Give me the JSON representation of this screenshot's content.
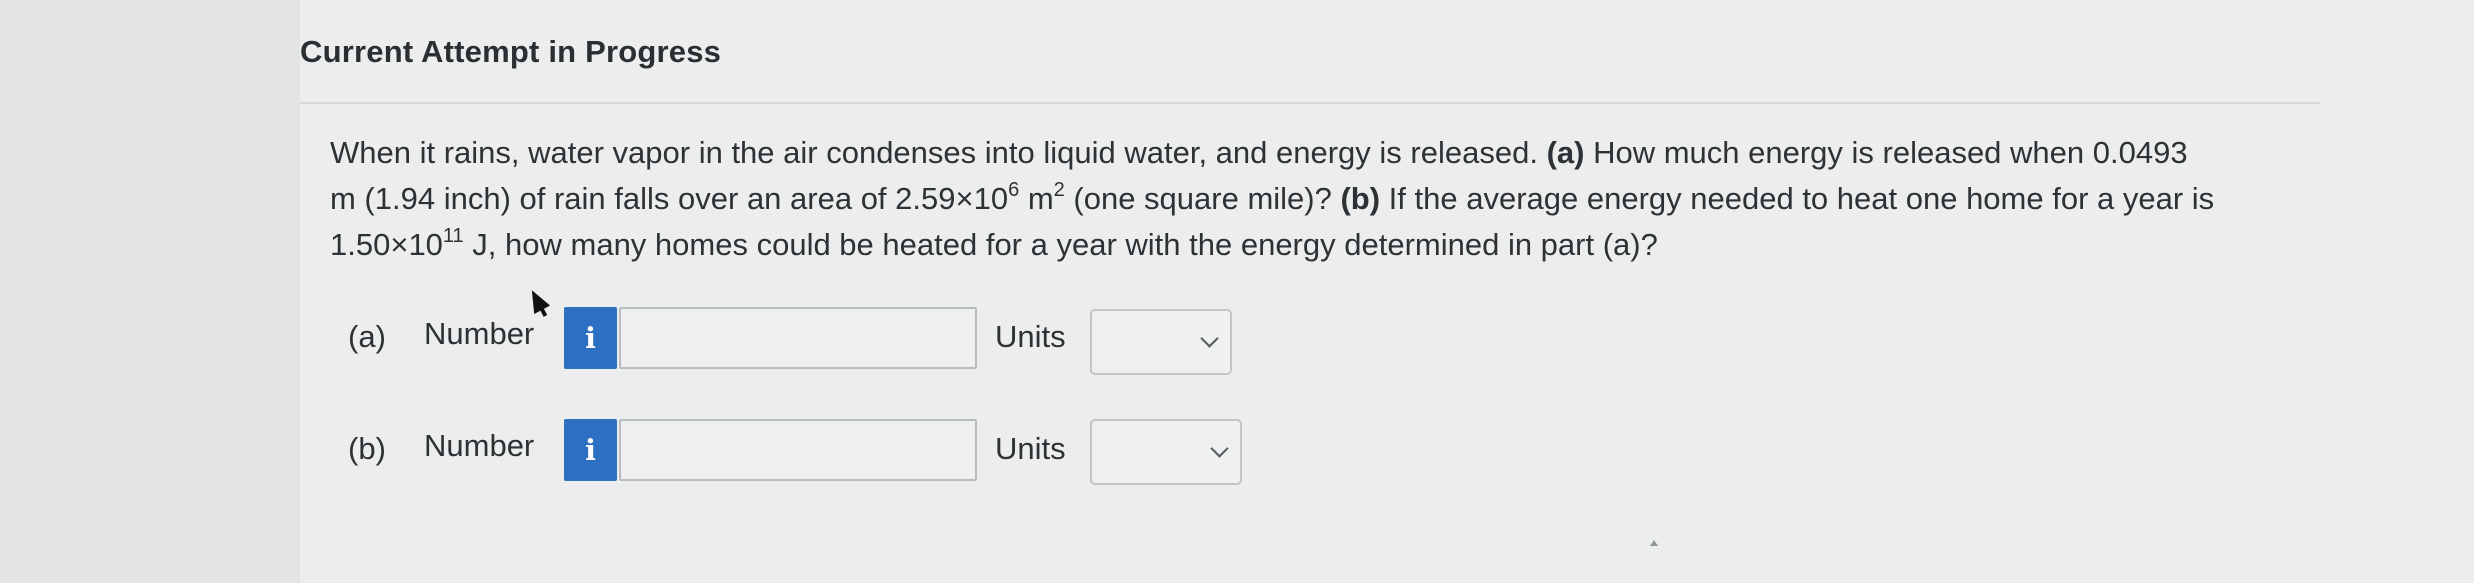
{
  "header": {
    "title": "Current Attempt in Progress"
  },
  "question": {
    "line1_pre": "When it rains, water vapor in the air condenses into liquid water, and energy is released. ",
    "label_a": "(a)",
    "line1_post": " How much energy is released when 0.0493",
    "line2_pre": "m (1.94 inch) of rain falls over an area of 2.59×10",
    "exp_area": "6",
    "line2_mid": " m",
    "exp_m": "2",
    "line2_post": " (one square mile)? ",
    "label_b": "(b)",
    "line2_tail": " If the average energy needed to heat one home for a year is",
    "line3_pre": "1.50×10",
    "exp_energy": "11",
    "line3_post": " J, how many homes could be heated for a year with the energy determined in part (a)?"
  },
  "answers": {
    "a": {
      "part_label": "(a)",
      "number_label": "Number",
      "info_glyph": "i",
      "number_value": "",
      "units_label": "Units",
      "units_value": ""
    },
    "b": {
      "part_label": "(b)",
      "number_label": "Number",
      "info_glyph": "i",
      "number_value": "",
      "units_label": "Units",
      "units_value": ""
    }
  },
  "colors": {
    "info_button": "#2d6fc1",
    "background": "#eceded",
    "text": "#2e3136"
  },
  "icons": {
    "info": "info-icon",
    "dropdown": "chevron-down-icon",
    "cursor": "mouse-pointer-icon"
  }
}
